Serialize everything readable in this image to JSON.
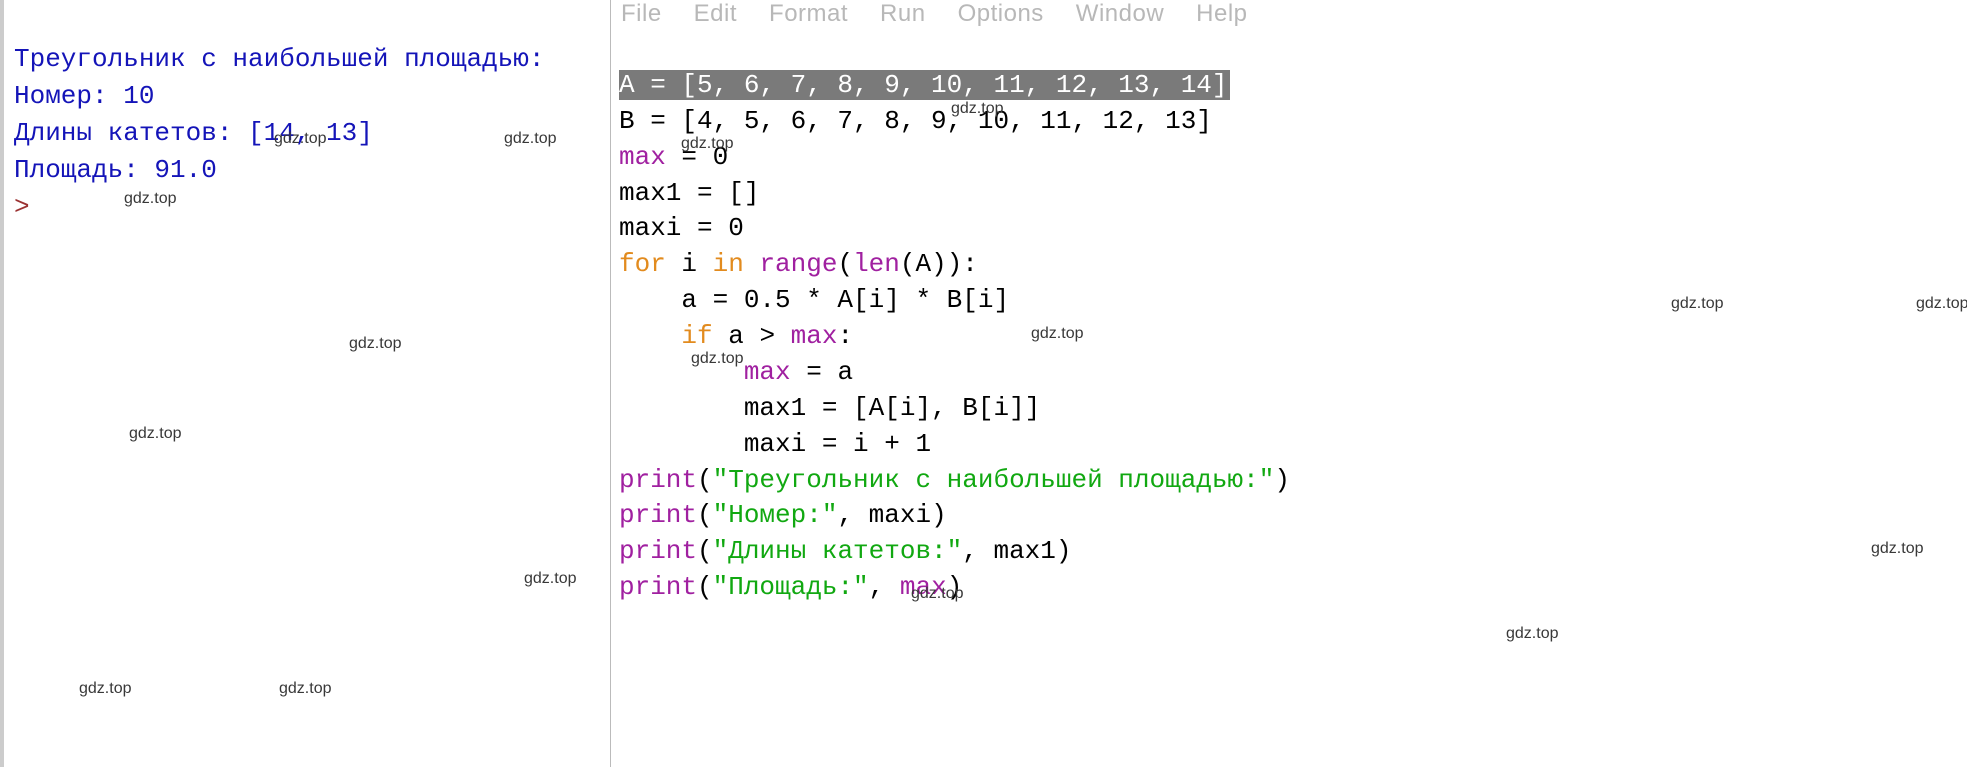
{
  "menu": {
    "file": "File",
    "edit": "Edit",
    "format": "Format",
    "run": "Run",
    "options": "Options",
    "window": "Window",
    "help": "Help"
  },
  "shell": {
    "line1": "Треугольник с наибольшей площадью:",
    "line2": "Номер: 10",
    "line3": "Длины катетов: [14, 13]",
    "line4": "Площадь: 91.0",
    "prompt": ">"
  },
  "code": {
    "l1_sel": "A = [5, 6, 7, 8, 9, 10, 11, 12, 13, 14]",
    "l2": "B = [4, 5, 6, 7, 8, 9, 10, 11, 12, 13]",
    "l3a": "max",
    "l3b": " = 0",
    "l4": "max1 = []",
    "l5": "maxi = 0",
    "l6_for": "for",
    "l6_mid": " i ",
    "l6_in": "in",
    "l6_sp": " ",
    "l6_range": "range",
    "l6_p1": "(",
    "l6_len": "len",
    "l6_rest": "(A)):",
    "l7": "    a = 0.5 * A[i] * B[i]",
    "l8_pad": "    ",
    "l8_if": "if",
    "l8_a": " a > ",
    "l8_max": "max",
    "l8_c": ":",
    "l9_pad": "        ",
    "l9_max": "max",
    "l9_b": " = a",
    "l10": "        max1 = [A[i], B[i]]",
    "l11": "        maxi = i + 1",
    "l12_p": "print",
    "l12_a": "(",
    "l12_s": "\"Треугольник с наибольшей площадью:\"",
    "l12_b": ")",
    "l13_p": "print",
    "l13_a": "(",
    "l13_s": "\"Номер:\"",
    "l13_b": ", maxi)",
    "l14_p": "print",
    "l14_a": "(",
    "l14_s": "\"Длины катетов:\"",
    "l14_b": ", max1)",
    "l15_p": "print",
    "l15_a": "(",
    "l15_s": "\"Площадь:\"",
    "l15_b": ", ",
    "l15_max": "max",
    "l15_c": ")"
  },
  "wm": "gdz.top"
}
